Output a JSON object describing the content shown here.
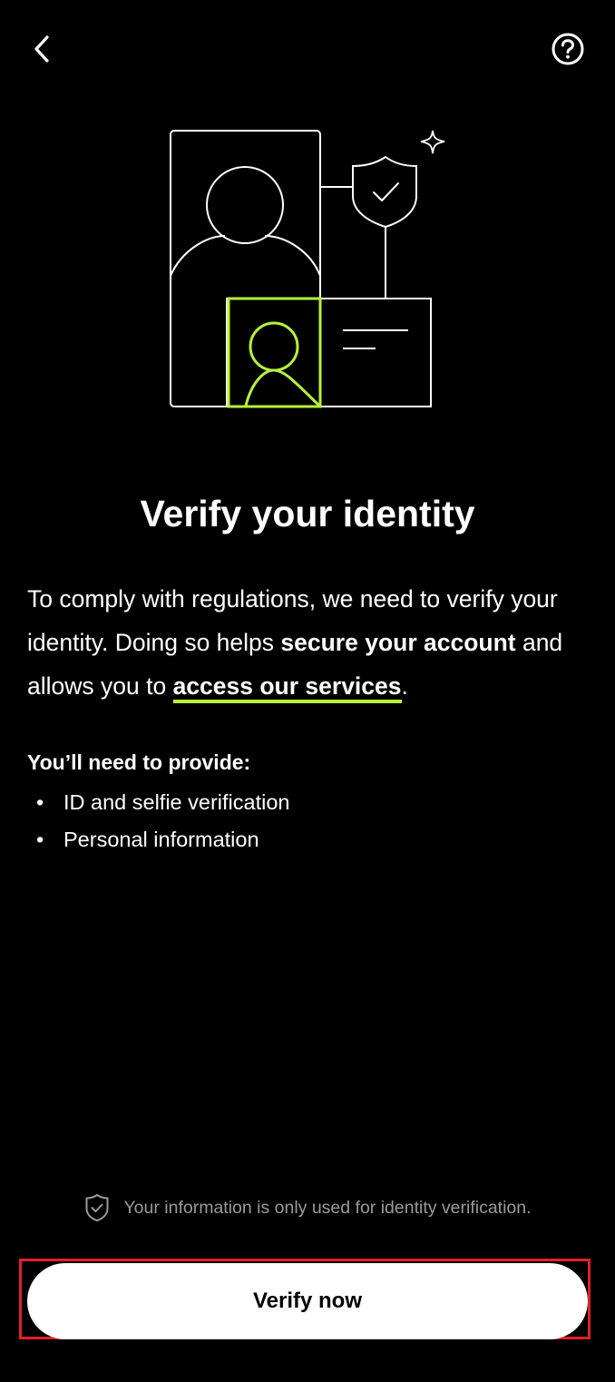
{
  "header": {
    "back_icon": "chevron-left-icon",
    "help_icon": "question-circle-icon"
  },
  "illustration": {
    "accent_color": "#b6f23a",
    "line_color": "#ffffff",
    "icons": [
      "person-portrait-icon",
      "shield-check-icon",
      "sparkle-icon",
      "id-card-icon"
    ]
  },
  "main": {
    "title": "Verify your identity",
    "description": {
      "part1": "To comply with regulations, we need to verify your identity. Doing so helps ",
      "bold1": "secure your account",
      "part2": " and allows you to ",
      "link": "access our services",
      "part3": "."
    },
    "requirements": {
      "heading": "You’ll need to provide:",
      "bullet": "•",
      "items": [
        {
          "label": "ID and selfie verification"
        },
        {
          "label": "Personal information"
        }
      ]
    }
  },
  "footer": {
    "privacy_icon": "shield-check-icon",
    "privacy_text": "Your information is only used for identity verification.",
    "verify_label": "Verify now"
  },
  "colors": {
    "background": "#000000",
    "text": "#ffffff",
    "muted_text": "#9a9a9a",
    "accent": "#b6f23a",
    "highlight": "#e0202a"
  }
}
